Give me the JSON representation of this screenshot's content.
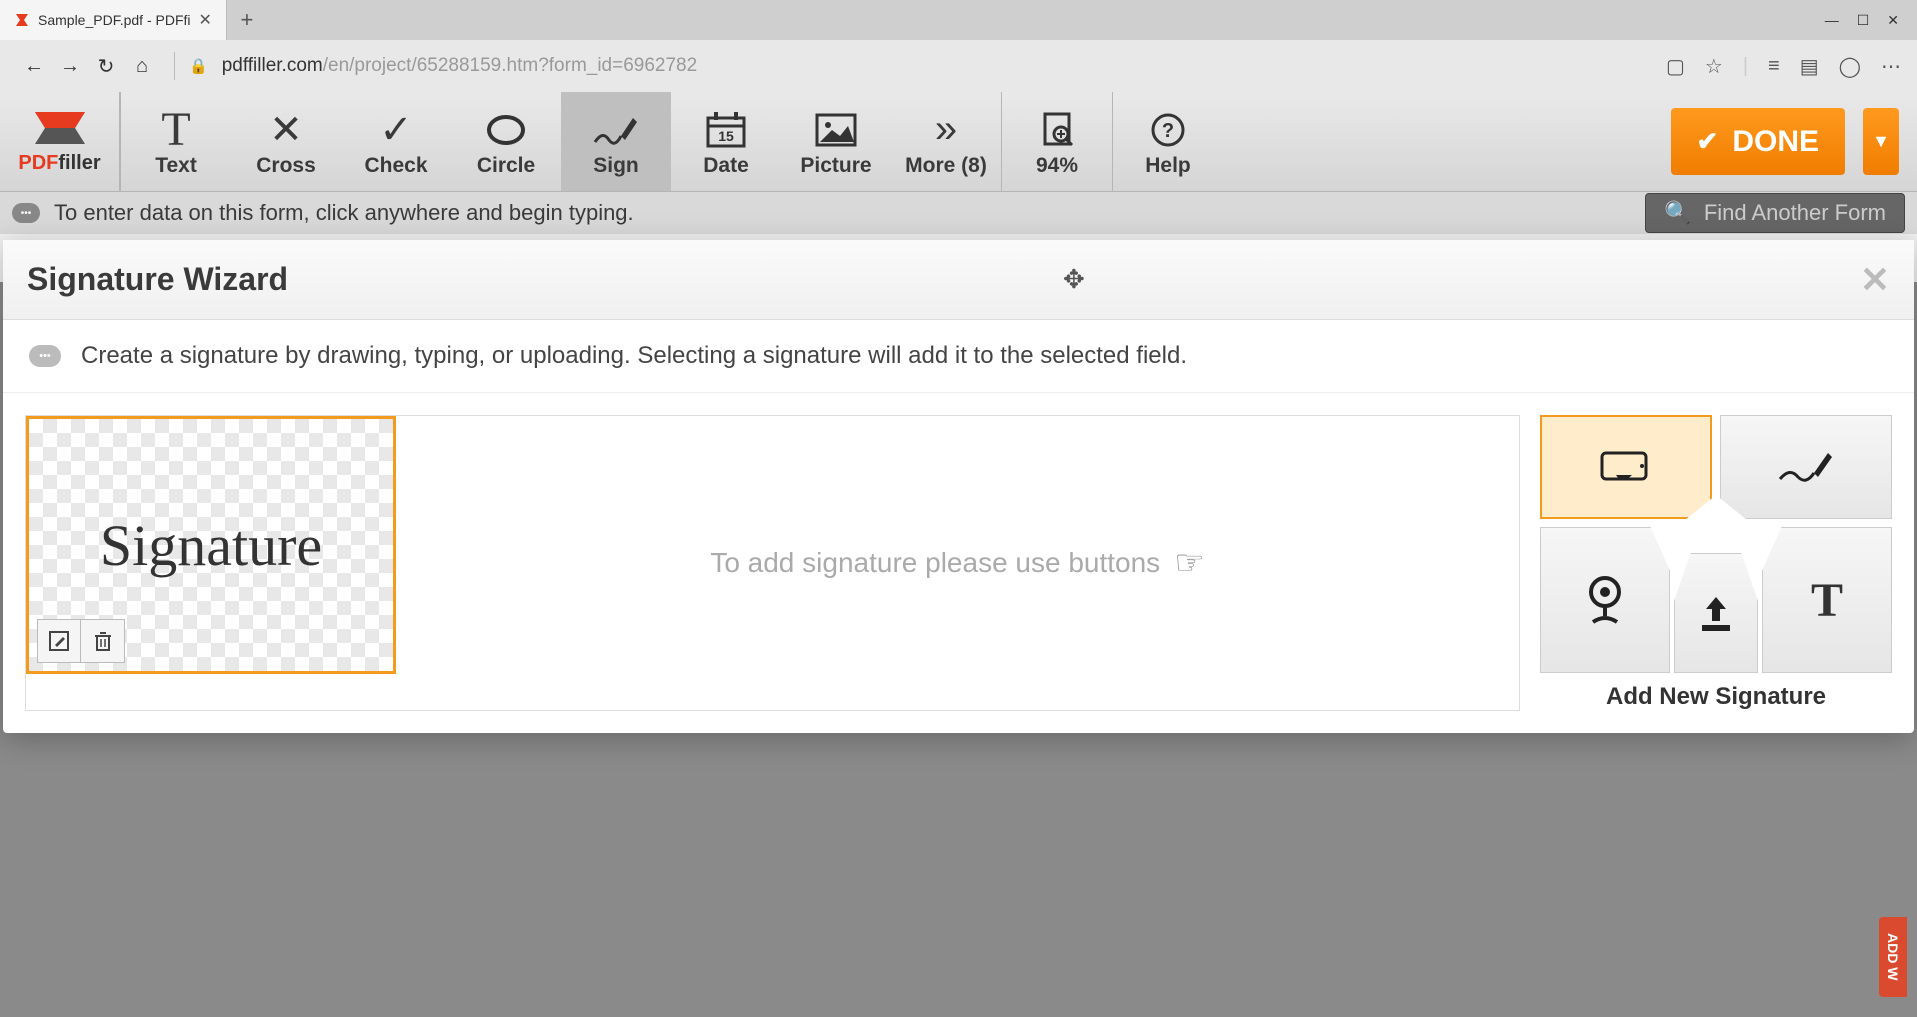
{
  "browser": {
    "tab_title": "Sample_PDF.pdf - PDFfi",
    "url_host": "pdffiller.com",
    "url_path": "/en/project/65288159.htm?form_id=6962782"
  },
  "logo": {
    "pdf": "PDF",
    "filler": "filler"
  },
  "toolbar": {
    "text": "Text",
    "cross": "Cross",
    "check": "Check",
    "circle": "Circle",
    "sign": "Sign",
    "date": "Date",
    "date_num": "15",
    "picture": "Picture",
    "more": "More (8)",
    "zoom": "94%",
    "help": "Help",
    "done": "DONE"
  },
  "subheader": {
    "hint": "To enter data on this form, click anywhere and begin typing.",
    "find": "Find Another Form"
  },
  "modal": {
    "title": "Signature Wizard",
    "subtitle": "Create a signature by drawing, typing, or uploading. Selecting a signature will add it to the selected field.",
    "sig_text": "Signature",
    "placeholder": "To add signature please use buttons",
    "add_label": "Add New Signature"
  },
  "side_tag": "ADD W"
}
